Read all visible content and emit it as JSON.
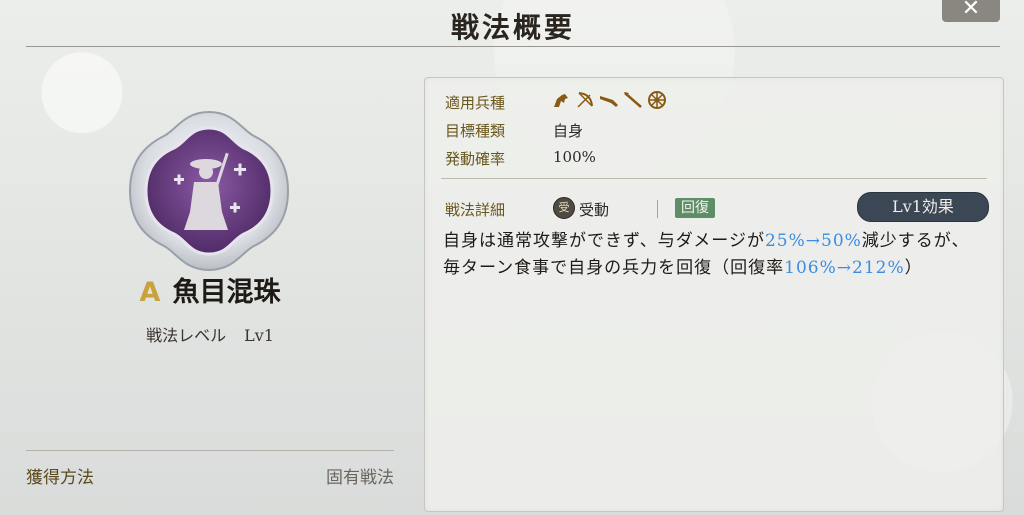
{
  "header": {
    "title": "戦法概要",
    "close_label": "✕"
  },
  "skill": {
    "rank": "A",
    "name": "魚目混珠",
    "level_label": "戦法レベル",
    "level_value": "Lv1"
  },
  "acquire": {
    "label": "獲得方法",
    "value": "固有戦法"
  },
  "info": {
    "unit_type_label": "適用兵種",
    "unit_icons": [
      "cavalry-icon",
      "archer-icon",
      "gunner-icon",
      "spear-icon",
      "siege-icon"
    ],
    "target_label": "目標種類",
    "target_value": "自身",
    "chance_label": "発動確率",
    "chance_value": "100%"
  },
  "detail": {
    "label": "戦法詳細",
    "passive_icon_text": "受",
    "type": "受動",
    "tag": "回復",
    "effect_button": "Lv1効果",
    "desc_1": "自身は通常攻撃ができず、与ダメージが",
    "desc_hl_1": "25%→50%",
    "desc_2": "減少するが、毎ターン食事で自身の兵力を回復（回復率",
    "desc_hl_2": "106%→212%",
    "desc_3": "）"
  },
  "colors": {
    "highlight": "#3a8de0",
    "rank": "#c9a23d",
    "emblem": "#6b3f82",
    "tag": "#5f8d68"
  }
}
